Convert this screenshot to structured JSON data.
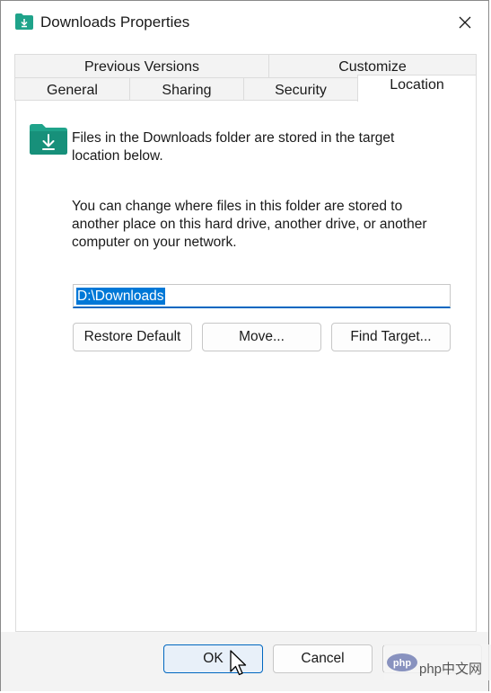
{
  "window": {
    "title": "Downloads Properties"
  },
  "tabs": {
    "row1": [
      "Previous Versions",
      "Customize"
    ],
    "row2": [
      "General",
      "Sharing",
      "Security",
      "Location"
    ],
    "active": "Location"
  },
  "location": {
    "info": "Files in the Downloads folder are stored in the target location below.",
    "info_line1": "Files in the Downloads folder are stored in the target",
    "info_line2": "location below.",
    "desc_line1": "You can change where files in this folder are stored to",
    "desc_line2": "another place on this hard drive, another drive, or another",
    "desc_line3": "computer on your network.",
    "path_value": "D:\\Downloads",
    "buttons": {
      "restore": "Restore Default",
      "move": "Move...",
      "find": "Find Target..."
    }
  },
  "footer": {
    "ok": "OK",
    "cancel": "Cancel"
  },
  "watermark": {
    "text": "php中文网"
  },
  "colors": {
    "accent": "#0067c0",
    "selection": "#0078d7",
    "folder": "#1fa38a"
  },
  "icons": [
    "downloads-folder-icon",
    "close-icon",
    "mouse-cursor-icon"
  ]
}
